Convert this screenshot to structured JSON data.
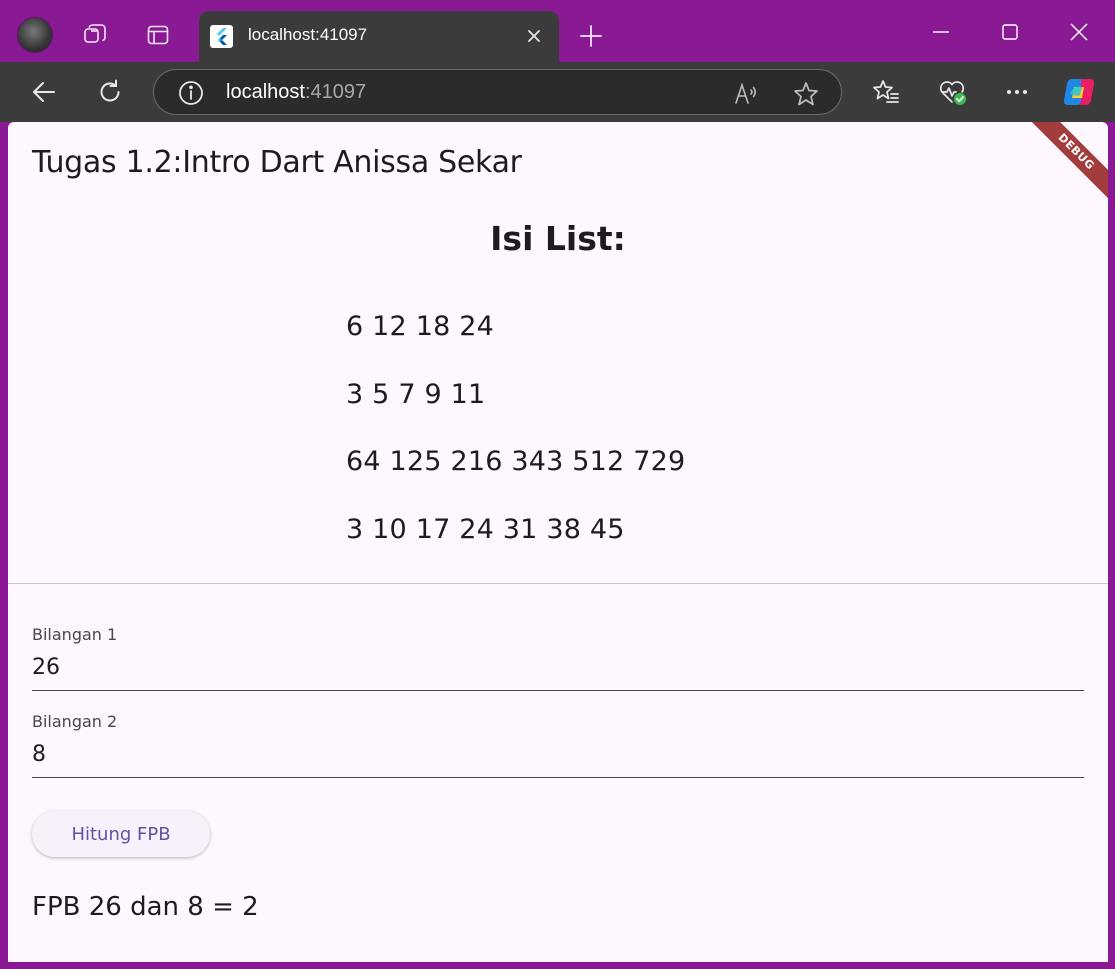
{
  "browser": {
    "tab_title": "localhost:41097",
    "url_host": "localhost",
    "url_port": ":41097",
    "icons": [
      "profile-avatar",
      "workspaces-icon",
      "tab-actions-icon",
      "flutter-favicon",
      "close-icon",
      "plus-icon",
      "minimize-icon",
      "maximize-icon",
      "window-close-icon",
      "back-icon",
      "refresh-icon",
      "info-icon",
      "read-aloud-icon",
      "star-icon",
      "favorites-icon",
      "browser-essentials-icon",
      "more-icon",
      "copilot-icon"
    ]
  },
  "app": {
    "title": "Tugas 1.2:Intro Dart Anissa Sekar",
    "debug_banner": "DEBUG",
    "list_heading": "Isi List:",
    "list_lines": [
      "6 12 18 24",
      "3 5 7 9 11",
      "64 125 216 343 512 729",
      "3 10 17 24 31 38 45"
    ],
    "field1": {
      "label": "Bilangan 1",
      "value": "26"
    },
    "field2": {
      "label": "Bilangan 2",
      "value": "8"
    },
    "button_label": "Hitung FPB",
    "result": "FPB 26 dan 8 = 2"
  },
  "colors": {
    "titlebar": "#8a1a94",
    "toolbar": "#3b3b3b",
    "page_background": "#fef7fe",
    "button_text": "#6750a4",
    "debug_banner": "#a33d3d"
  }
}
